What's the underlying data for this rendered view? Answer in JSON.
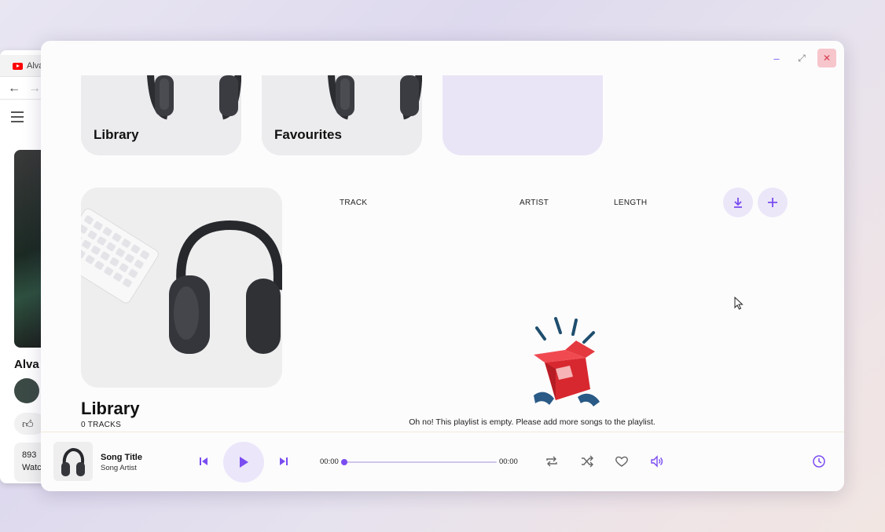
{
  "background_browser": {
    "tab_title": "Alva",
    "video_title": "Alva",
    "desc_line1": "893",
    "desc_line2": "Watc"
  },
  "window_controls": {
    "minimize": "–",
    "maximize": "⤢",
    "close": "✕"
  },
  "cards": [
    {
      "label": "Library"
    },
    {
      "label": "Favourites"
    },
    {
      "label": ""
    }
  ],
  "playlist": {
    "title": "Library",
    "count": "0 TRACKS",
    "columns": {
      "track": "TRACK",
      "artist": "ARTIST",
      "length": "LENGTH"
    },
    "empty_message": "Oh no! This playlist is empty. Please add more songs to the playlist."
  },
  "player": {
    "song_title": "Song Title",
    "song_artist": "Song Artist",
    "current_time": "00:00",
    "total_time": "00:00",
    "progress": 0
  },
  "colors": {
    "accent": "#7a4df0",
    "accent_soft": "#ebe6f8",
    "close_bg": "#f7c6cc"
  },
  "icons": {
    "download": "download-icon",
    "add": "plus-icon",
    "prev": "skip-previous-icon",
    "play": "play-icon",
    "next": "skip-next-icon",
    "repeat": "repeat-icon",
    "shuffle": "shuffle-icon",
    "favourite": "heart-icon",
    "volume": "volume-icon",
    "history": "clock-icon"
  }
}
